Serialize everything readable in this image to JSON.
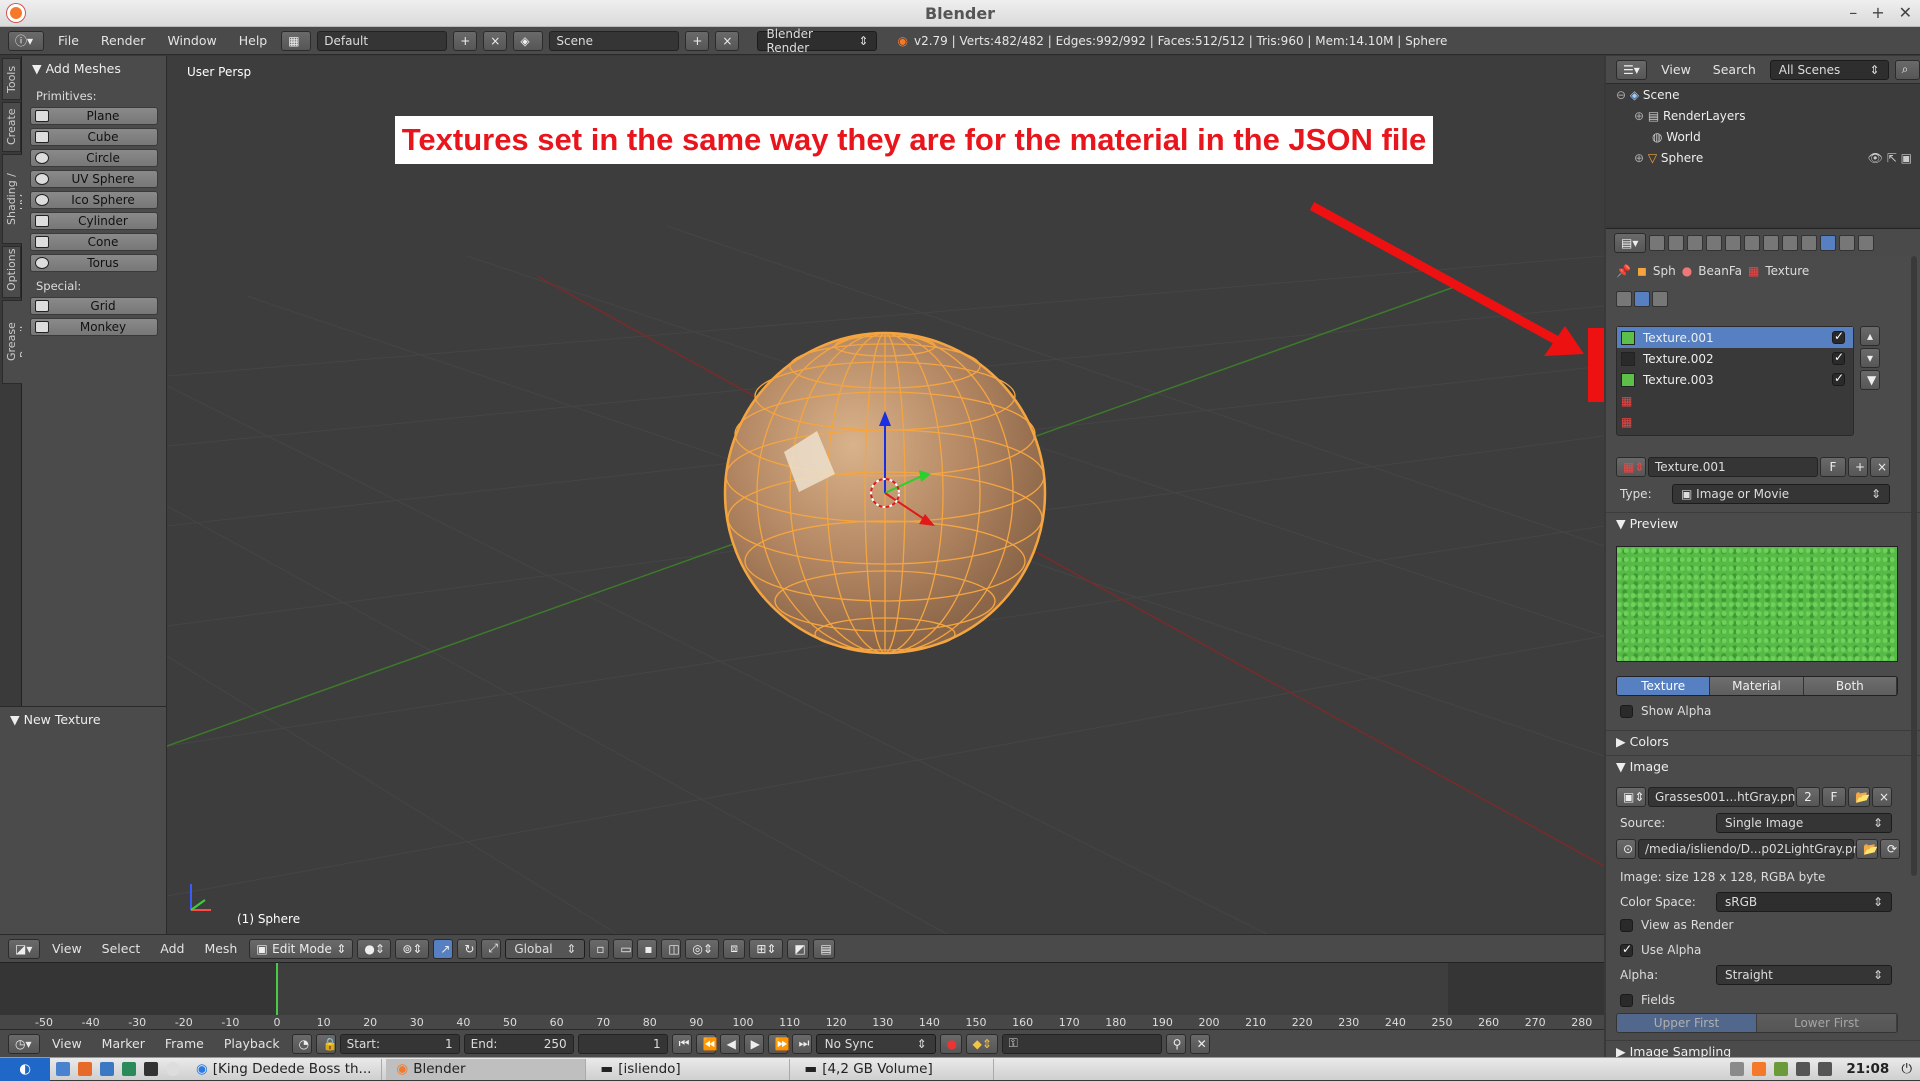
{
  "window": {
    "title": "Blender"
  },
  "info": {
    "menus": [
      "File",
      "Render",
      "Window",
      "Help"
    ],
    "screen": "Default",
    "scene": "Scene",
    "engine": "Blender Render",
    "stats": "v2.79 | Verts:482/482 | Edges:992/992 | Faces:512/512 | Tris:960 | Mem:14.10M | Sphere"
  },
  "left_tabs": [
    "Tools",
    "Create",
    "Shading / UVs",
    "Options",
    "Grease Pencil"
  ],
  "toolshelf": {
    "header": "Add Meshes",
    "primitives_label": "Primitives:",
    "primitives": [
      "Plane",
      "Cube",
      "Circle",
      "UV Sphere",
      "Ico Sphere",
      "Cylinder",
      "Cone",
      "Torus"
    ],
    "special_label": "Special:",
    "special": [
      "Grid",
      "Monkey"
    ],
    "operator_panel": "New Texture"
  },
  "viewport": {
    "view_name": "User Persp",
    "object_label": "(1) Sphere",
    "annotation": "Textures set in the same way they are for the material in the JSON file"
  },
  "viewport_header": {
    "menus": [
      "View",
      "Select",
      "Add",
      "Mesh"
    ],
    "mode": "Edit Mode",
    "orientation": "Global"
  },
  "timeline": {
    "ticks": [
      "-50",
      "-40",
      "-30",
      "-20",
      "-10",
      "0",
      "10",
      "20",
      "30",
      "40",
      "50",
      "60",
      "70",
      "80",
      "90",
      "100",
      "110",
      "120",
      "130",
      "140",
      "150",
      "160",
      "170",
      "180",
      "190",
      "200",
      "210",
      "220",
      "230",
      "240",
      "250",
      "260",
      "270",
      "280"
    ]
  },
  "timeline_header": {
    "menus": [
      "View",
      "Marker",
      "Frame",
      "Playback"
    ],
    "start_label": "Start:",
    "start": "1",
    "end_label": "End:",
    "end": "250",
    "current": "1",
    "sync": "No Sync"
  },
  "outliner": {
    "menus": [
      "View",
      "Search"
    ],
    "filter": "All Scenes",
    "items": [
      "Scene",
      "RenderLayers",
      "World",
      "Sphere"
    ]
  },
  "properties": {
    "breadcrumb": [
      "Sph",
      "BeanFa",
      "Texture"
    ],
    "textures": [
      {
        "name": "Texture.001",
        "color": "#5bbf4a",
        "checked": true
      },
      {
        "name": "Texture.002",
        "color": "#2a2a2a",
        "checked": true
      },
      {
        "name": "Texture.003",
        "color": "#5bbf4a",
        "checked": true
      }
    ],
    "texture_name": "Texture.001",
    "type_label": "Type:",
    "type": "Image or Movie",
    "preview_header": "Preview",
    "preview_tabs": [
      "Texture",
      "Material",
      "Both"
    ],
    "show_alpha": "Show Alpha",
    "colors_header": "Colors",
    "image_header": "Image",
    "image_name": "Grasses001...htGray.png",
    "image_users": "2",
    "f": "F",
    "source_label": "Source:",
    "source": "Single Image",
    "path": "/media/isliendo/D...p02LightGray.png",
    "image_info": "Image: size 128 x 128, RGBA byte",
    "colorspace_label": "Color Space:",
    "colorspace": "sRGB",
    "view_as_render": "View as Render",
    "use_alpha": "Use Alpha",
    "alpha_label": "Alpha:",
    "alpha": "Straight",
    "fields": "Fields",
    "field_order": [
      "Upper First",
      "Lower First"
    ],
    "image_sampling": "Image Sampling"
  },
  "taskbar": {
    "tasks": [
      "[King Dedede Boss th...",
      "Blender",
      "[isliendo]",
      "[4,2 GB Volume]"
    ],
    "clock": "21:08"
  },
  "colors": {
    "accent": "#5680c2",
    "annotation_red": "#e8161c",
    "selection_orange": "#f5a540"
  }
}
